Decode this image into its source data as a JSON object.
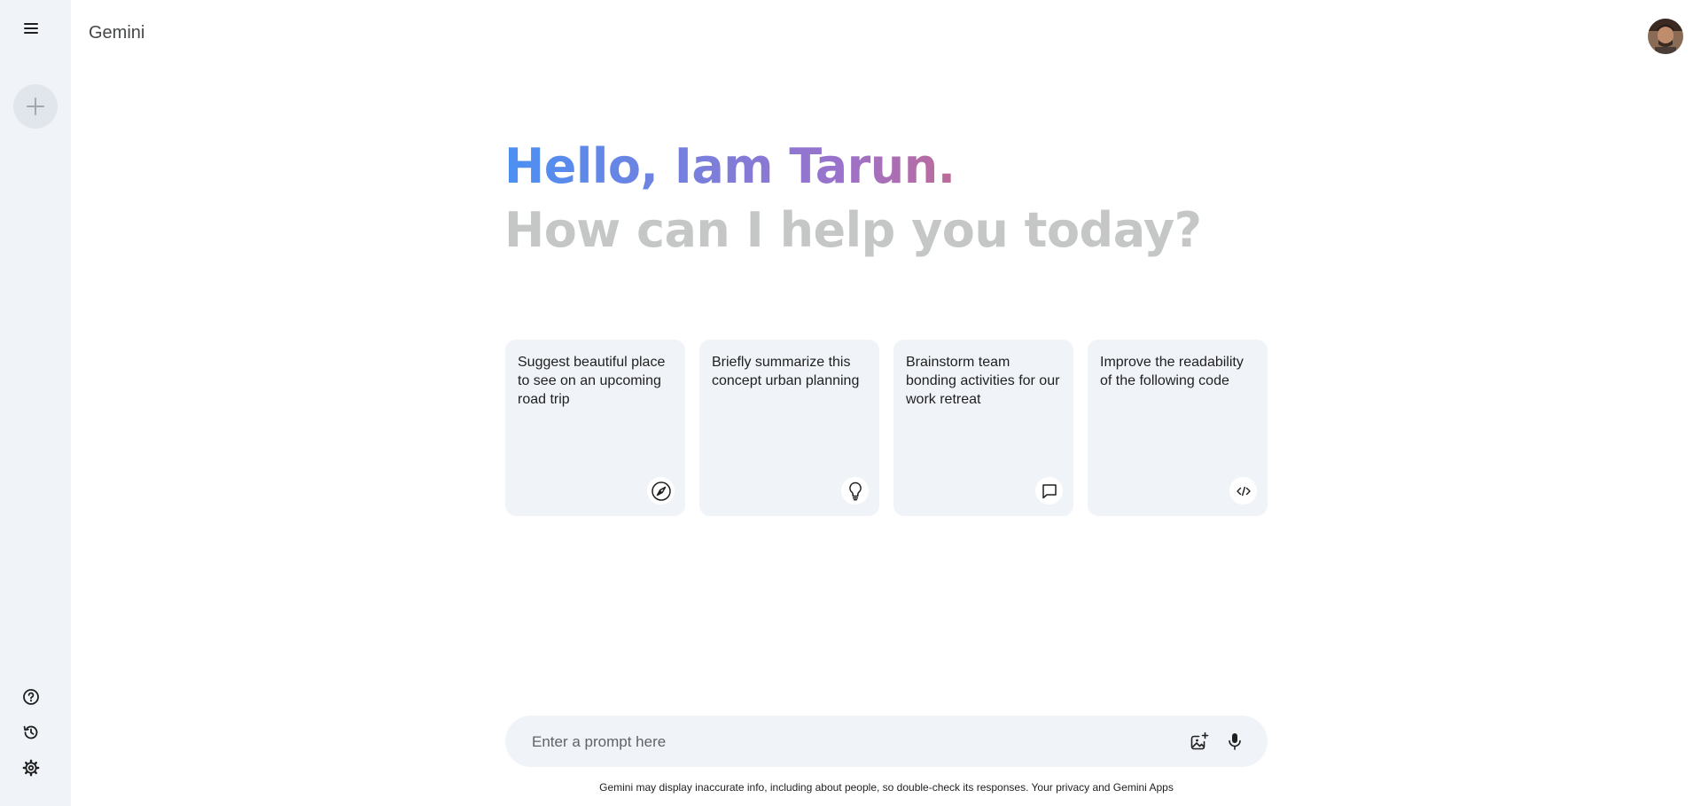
{
  "header": {
    "brand": "Gemini"
  },
  "greeting": {
    "line1": "Hello, Iam Tarun.",
    "line2": "How can I help you today?"
  },
  "cards": [
    {
      "text": "Suggest beautiful place to see on an upcoming road trip",
      "icon": "compass-icon"
    },
    {
      "text": "Briefly summarize this concept urban planning",
      "icon": "lightbulb-icon"
    },
    {
      "text": "Brainstorm team bonding activities for our work retreat",
      "icon": "message-icon"
    },
    {
      "text": "Improve the readability of the following code",
      "icon": "code-icon"
    }
  ],
  "prompt": {
    "placeholder": "Enter a prompt here",
    "value": ""
  },
  "footer": {
    "disclaimer": "Gemini may display inaccurate info, including about people, so double-check its responses. Your privacy and Gemini Apps"
  },
  "sidebar": {
    "bottom_icons": [
      "help-icon",
      "history-icon",
      "settings-icon"
    ]
  },
  "colors": {
    "sidebar_bg": "#f0f4f9",
    "card_bg": "#f0f4f9",
    "gradient": [
      "#4b90f3",
      "#9b72cb",
      "#d96570",
      "#ea4335"
    ],
    "subtitle": "#c4c7c5"
  }
}
